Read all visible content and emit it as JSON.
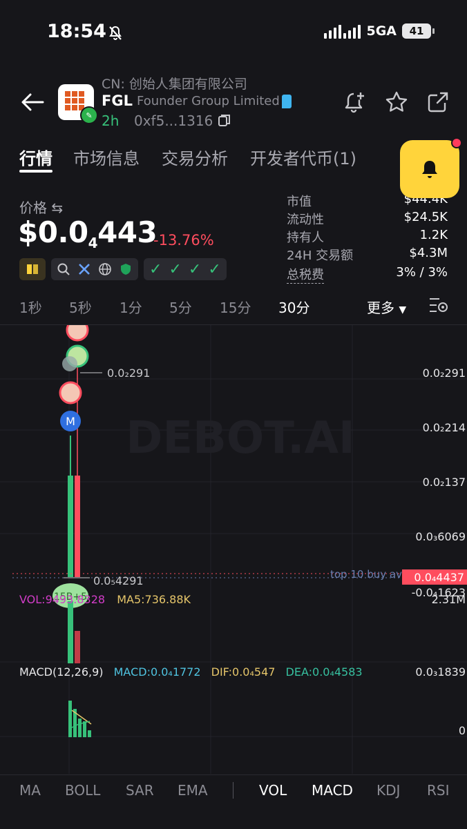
{
  "status_bar": {
    "time": "18:54",
    "network": "5GA",
    "battery": "41"
  },
  "token": {
    "cn_name": "CN: 创始人集团有限公司",
    "symbol": "FGL",
    "full_name": "Founder Group Limited",
    "age": "2h",
    "address": "0xf5...1316"
  },
  "tabs": [
    "行情",
    "市场信息",
    "交易分析",
    "开发者代币(1)"
  ],
  "price": {
    "label": "价格 ⇆",
    "prefix": "$0.0",
    "sub": "4",
    "rest": "443",
    "change": "-13.76%"
  },
  "stats": [
    {
      "label": "市值",
      "value": "$44.4K"
    },
    {
      "label": "流动性",
      "value": "$24.5K"
    },
    {
      "label": "持有人",
      "value": "1.2K"
    },
    {
      "label": "24H 交易额",
      "value": "$4.3M"
    },
    {
      "label": "总税费",
      "value": "3% / 3%"
    }
  ],
  "timeframes": [
    "1秒",
    "5秒",
    "1分",
    "5分",
    "15分",
    "30分"
  ],
  "timeframe_active": "30分",
  "more_label": "更多",
  "chart": {
    "watermark": "DEBOT.AI",
    "y_axis": [
      "0.0₂291",
      "0.0₂214",
      "0.0₂137",
      "0.0₃6069",
      "0.0₄4437",
      "-0.0₄1623",
      "2.31M",
      "0.0₃1839",
      "0"
    ],
    "high_label": "0.0₂291",
    "low_label": "0.0₅4291",
    "marker_label": "M",
    "badge_label": "15B+5",
    "top10_label": "top 10 buy av",
    "vol_legend": {
      "vol": "VOL:9493.8328",
      "ma5": "MA5:736.88K"
    },
    "macd_legend": {
      "title": "MACD(12,26,9)",
      "macd": "MACD:0.0₄1772",
      "dif": "DIF:0.0₄547",
      "dea": "DEA:0.0₄4583"
    }
  },
  "indicators": [
    "MA",
    "BOLL",
    "SAR",
    "EMA",
    "VOL",
    "MACD",
    "KDJ",
    "RSI"
  ],
  "indicators_active": [
    "VOL",
    "MACD"
  ],
  "colors": {
    "up": "#37c17a",
    "down": "#ff4d5e",
    "accent": "#ffd43b"
  }
}
